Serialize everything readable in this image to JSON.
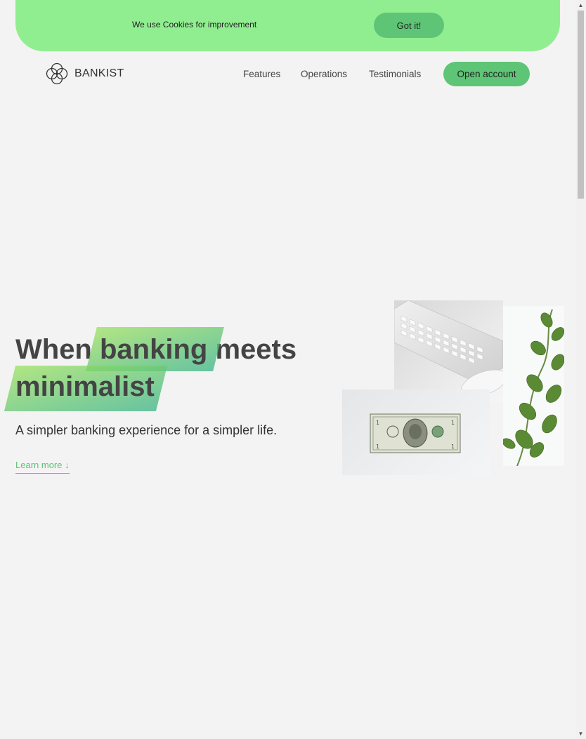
{
  "cookie_banner": {
    "message": "We use Cookies for improvement",
    "button_label": "Got it!"
  },
  "nav": {
    "logo_text": "BANKIST",
    "links": [
      "Features",
      "Operations",
      "Testimonials"
    ],
    "cta_label": "Open account"
  },
  "hero": {
    "title_word_1": "When",
    "title_highlight_1": "banking",
    "title_word_2": "meets",
    "title_highlight_2": "minimalist",
    "subtitle": "A simpler banking experience for a simpler life.",
    "learn_more": "Learn more ↓"
  },
  "colors": {
    "primary": "#5ec576",
    "banner": "#90ee90",
    "background": "#f3f3f3",
    "text": "#444444"
  },
  "icons": [
    "bankist-logo-icon",
    "keyboard-mouse-image",
    "dollar-bill-image",
    "plant-image"
  ]
}
